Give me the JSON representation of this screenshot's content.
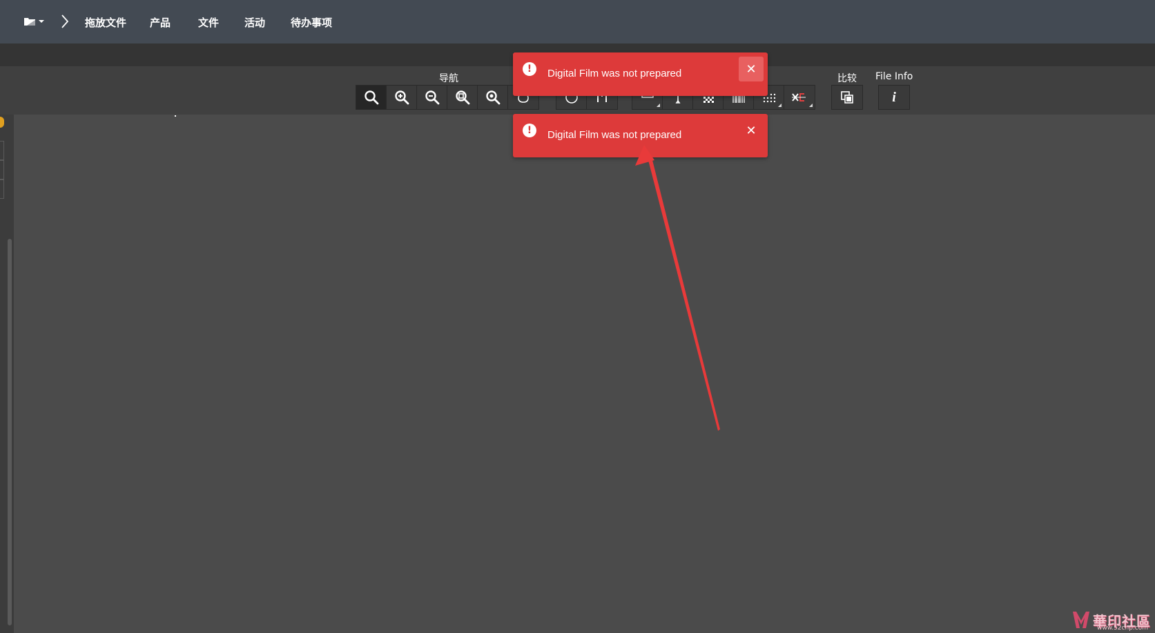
{
  "topnav": {
    "items": [
      "拖放文件",
      "产品",
      "文件",
      "活动",
      "待办事项"
    ]
  },
  "toolbar": {
    "groups": {
      "navigation": "导航",
      "compare": "比较",
      "file_info": "File Info"
    },
    "file_info_glyph": "i"
  },
  "toasts": [
    {
      "message": "Digital Film was not prepared",
      "close": "✕"
    },
    {
      "message": "Digital Film was not prepared",
      "close": "✕"
    }
  ],
  "watermark": {
    "text": "華印社區",
    "sub": "www.52cnp.com"
  },
  "colors": {
    "topbar": "#434a53",
    "toast": "#dd3a3a",
    "canvas": "#4b4b4b",
    "arrow": "#e83a3a"
  },
  "icons": {
    "folder": "folder-icon",
    "chevron": "chevron-right-icon",
    "search": "search-icon",
    "zoom_in": "zoom-in-icon",
    "zoom_out": "zoom-out-icon",
    "zoom_fit": "zoom-fit-icon",
    "zoom_actual": "zoom-actual-icon",
    "hand": "hand-icon",
    "alert": "alert-icon",
    "close": "close-icon",
    "compare": "compare-icon",
    "info": "info-icon"
  }
}
